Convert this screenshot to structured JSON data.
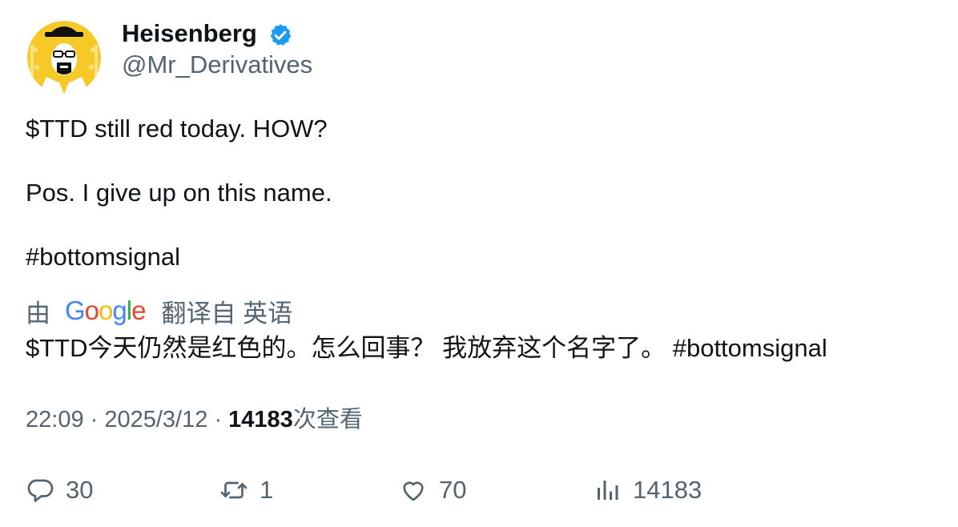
{
  "user": {
    "display_name": "Heisenberg",
    "handle": "@Mr_Derivatives",
    "verified": true,
    "avatar_icon": "heisenberg-avatar-icon"
  },
  "tweet": {
    "lines": [
      "$TTD still red today. HOW?",
      "Pos. I give up on this name.",
      "#bottomsignal"
    ]
  },
  "translation": {
    "prefix": "由",
    "provider": "Google",
    "suffix": "翻译自 英语",
    "text": "$TTD今天仍然是红色的。怎么回事？ 我放弃这个名字了。 #bottomsignal"
  },
  "meta": {
    "time": "22:09",
    "separator": "·",
    "date": "2025/3/12",
    "views_count": "14183",
    "views_label": "次查看"
  },
  "actions": {
    "replies": "30",
    "retweets": "1",
    "likes": "70",
    "views": "14183"
  },
  "colors": {
    "verified_blue": "#1d9bf0",
    "secondary_text": "#536471",
    "primary_text": "#0f1419",
    "avatar_yellow": "#f7c928"
  }
}
